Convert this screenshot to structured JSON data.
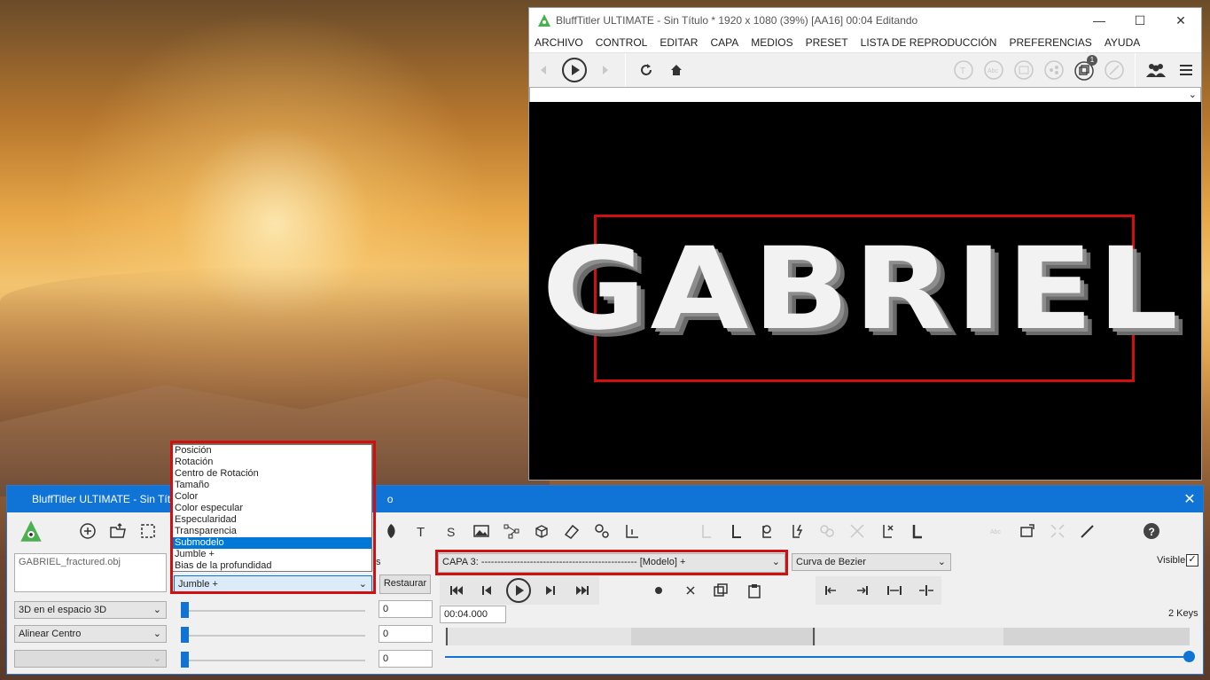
{
  "preview": {
    "title": "BluffTitler ULTIMATE  - Sin Título * 1920 x 1080 (39%) [AA16] 00:04 Editando",
    "menu": [
      "ARCHIVO",
      "CONTROL",
      "EDITAR",
      "CAPA",
      "MEDIOS",
      "PRESET",
      "LISTA DE REPRODUCCIÓN",
      "PREFERENCIAS",
      "AYUDA"
    ],
    "badge": "1",
    "text": "GABRIEL"
  },
  "editor": {
    "title": "BluffTitler ULTIMATE  - Sin Títu",
    "title_tail": "o",
    "filename": "GABRIEL_fractured.obj",
    "dropdown_items": [
      "Posición",
      "Rotación",
      "Centro de Rotación",
      "Tamaño",
      "Color",
      "Color especular",
      "Especularidad",
      "Transparencia",
      "Submodelo",
      "Jumble +",
      "Bias de la profundidad"
    ],
    "dropdown_selected_index": 8,
    "prop_combo": "Jumble +",
    "restore": "Restaurar",
    "hidden_label_tail": "s",
    "layer_combo": "CAPA 3: ------------------------------------------------ [Modelo] +",
    "curve_combo": "Curva de Bezier",
    "visible_label": "Visible",
    "time": "00:04.000",
    "keys": "2 Keys",
    "left_combos": [
      "3D en el espacio 3D",
      "Alinear Centro",
      ""
    ],
    "values": [
      "0",
      "0",
      "0"
    ]
  }
}
